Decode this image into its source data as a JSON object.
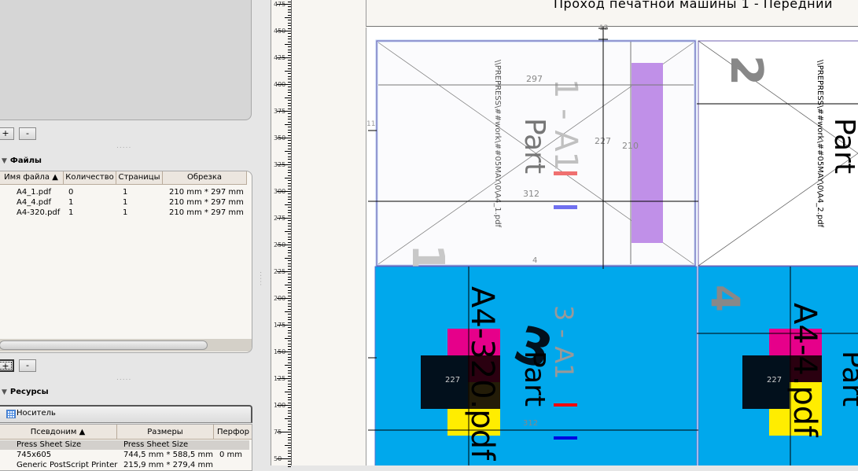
{
  "top_panel": {
    "add_label": "+",
    "remove_label": "-"
  },
  "files": {
    "title": "Файлы",
    "columns": [
      "Имя файла ▲",
      "Количество",
      "Страницы",
      "Обрезка"
    ],
    "rows": [
      {
        "name": "A4_1.pdf",
        "qty": "0",
        "pages": "1",
        "trim": "210 mm * 297 mm"
      },
      {
        "name": "A4_4.pdf",
        "qty": "1",
        "pages": "1",
        "trim": "210 mm * 297 mm"
      },
      {
        "name": "A4-320.pdf",
        "qty": "1",
        "pages": "1",
        "trim": "210 mm * 297 mm"
      }
    ],
    "add_label": "+",
    "remove_label": "-"
  },
  "resources": {
    "title": "Ресурсы",
    "tab": "Носитель",
    "columns": [
      "Псевдоним ▲",
      "Размеры",
      "Перфор"
    ],
    "rows": [
      {
        "alias": "Press Sheet Size",
        "size": "Press Sheet Size",
        "perf": ""
      },
      {
        "alias": "745x605",
        "size": "744,5 mm * 588,5 mm",
        "perf": "0 mm"
      },
      {
        "alias": "Generic PostScript Printer",
        "size": "215,9 mm * 279,4 mm",
        "perf": ""
      }
    ]
  },
  "ruler": {
    "labels": [
      "475",
      "450",
      "425",
      "400",
      "375",
      "350",
      "325",
      "300",
      "275",
      "250",
      "225",
      "200",
      "175",
      "150",
      "125",
      "100",
      "75",
      "50"
    ]
  },
  "canvas": {
    "title": "Проход печатной машины 1 - Передний",
    "page1": {
      "path": "\\\\PREPRESS\\##work\\##05MAY\\0\\A4_1.pdf",
      "part": "Part",
      "label": "1 - A1",
      "num": "1",
      "dim_w": "297",
      "dim_h": "210",
      "dim_227": "227",
      "dim_312": "312",
      "dim_12": "12",
      "dim_4": "4",
      "dim_11": "11"
    },
    "page2": {
      "path": "\\\\PREPRESS\\##work\\##05MAY\\0\\A4_2.pdf",
      "part": "Part",
      "num": "2"
    },
    "page3": {
      "file": "A4-320.pdf",
      "part": "Part",
      "label": "3 - A1",
      "num": "3",
      "dim_227": "227",
      "dim_312": "312"
    },
    "page4": {
      "file": "A4-4.pdf",
      "part": "Part",
      "num": "4",
      "dim_227": "227"
    }
  },
  "colors": {
    "cyan": "#00a8ec",
    "magenta": "#e6008a",
    "yellow": "#ffed00",
    "black": "#02101c",
    "purple": "#c090e8"
  }
}
